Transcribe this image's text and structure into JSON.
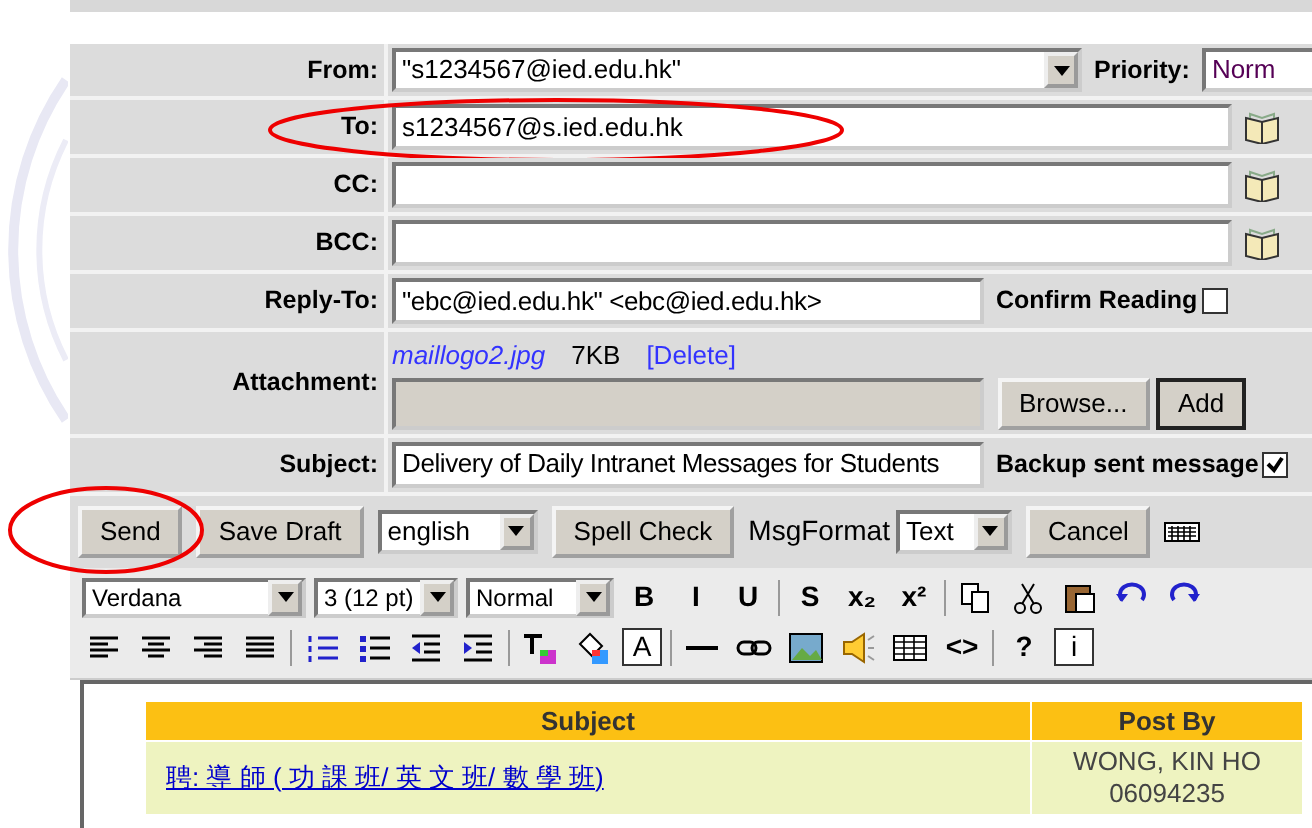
{
  "fields": [
    {
      "kind": "select",
      "label": "From:",
      "value": "\"s1234567@ied.edu.hk\"",
      "circled": false,
      "side": {
        "kind": "select",
        "label": "Priority:",
        "value": "Norm"
      }
    },
    {
      "kind": "text",
      "label": "To:",
      "value": "s1234567@s.ied.edu.hk",
      "circled": true,
      "side": {
        "kind": "book"
      }
    },
    {
      "kind": "text",
      "label": "CC:",
      "circled": false,
      "side": {
        "kind": "book"
      }
    },
    {
      "kind": "text",
      "label": "BCC:",
      "circled": false,
      "side": {
        "kind": "book"
      }
    },
    {
      "kind": "text",
      "label": "Reply-To:",
      "value": "\"ebc@ied.edu.hk\" <ebc@ied.edu.hk>",
      "circled": false,
      "side": {
        "kind": "check",
        "label": "Confirm Reading",
        "checked": false
      }
    },
    {
      "kind": "attach",
      "label": "Attachment:",
      "file": "maillogo2.jpg",
      "size": "7KB",
      "delete": "[Delete]",
      "browse": "Browse...",
      "add": "Add",
      "circled": false
    },
    {
      "kind": "text",
      "label": "Subject:",
      "value": "Delivery of Daily Intranet Messages for Students",
      "circled": false,
      "side": {
        "kind": "check",
        "label": "Backup sent message",
        "checked": true
      }
    }
  ],
  "actions": [
    {
      "kind": "button",
      "label": "Send",
      "circled": true
    },
    {
      "kind": "button",
      "label": "Save Draft",
      "circled": false
    },
    {
      "kind": "select",
      "value": "english"
    },
    {
      "kind": "button",
      "label": "Spell Check",
      "circled": false
    },
    {
      "kind": "label",
      "label": "MsgFormat"
    },
    {
      "kind": "select",
      "value": "Text"
    },
    {
      "kind": "button",
      "label": "Cancel",
      "circled": false
    },
    {
      "kind": "keyboard"
    }
  ],
  "toolbar_rows": [
    [
      {
        "kind": "select",
        "value": "Verdana"
      },
      {
        "kind": "select",
        "value": "3 (12 pt)"
      },
      {
        "kind": "select",
        "value": "Normal"
      },
      {
        "kind": "glyph",
        "label": "B"
      },
      {
        "kind": "glyph",
        "label": "I"
      },
      {
        "kind": "glyph",
        "label": "U"
      },
      {
        "kind": "sep"
      },
      {
        "kind": "glyph",
        "label": "S"
      },
      {
        "kind": "glyph",
        "label": "x₂"
      },
      {
        "kind": "glyph",
        "label": "x²"
      },
      {
        "kind": "sep"
      },
      {
        "kind": "copy"
      },
      {
        "kind": "cut"
      },
      {
        "kind": "paste"
      },
      {
        "kind": "undo"
      },
      {
        "kind": "redo"
      }
    ],
    [
      {
        "kind": "align-left"
      },
      {
        "kind": "align-center"
      },
      {
        "kind": "align-right"
      },
      {
        "kind": "align-justify"
      },
      {
        "kind": "sep"
      },
      {
        "kind": "ordered-list"
      },
      {
        "kind": "bullet-list"
      },
      {
        "kind": "outdent"
      },
      {
        "kind": "indent"
      },
      {
        "kind": "sep"
      },
      {
        "kind": "text-color"
      },
      {
        "kind": "fill-color"
      },
      {
        "kind": "glyph",
        "label": "A",
        "boxed": true
      },
      {
        "kind": "sep"
      },
      {
        "kind": "rule"
      },
      {
        "kind": "link"
      },
      {
        "kind": "image"
      },
      {
        "kind": "sound"
      },
      {
        "kind": "table"
      },
      {
        "kind": "glyph",
        "label": "<>"
      },
      {
        "kind": "sep"
      },
      {
        "kind": "glyph",
        "label": "?"
      },
      {
        "kind": "glyph",
        "label": "i",
        "boxed": true
      }
    ]
  ],
  "editor_table": {
    "columns": [
      "Subject",
      "Post By"
    ],
    "rows": [
      {
        "subject": "聘: 導 師 ( 功 課 班/ 英 文 班/ 數 學 班)",
        "post_by": "WONG, KIN HO",
        "post_id": "06094235"
      }
    ]
  }
}
